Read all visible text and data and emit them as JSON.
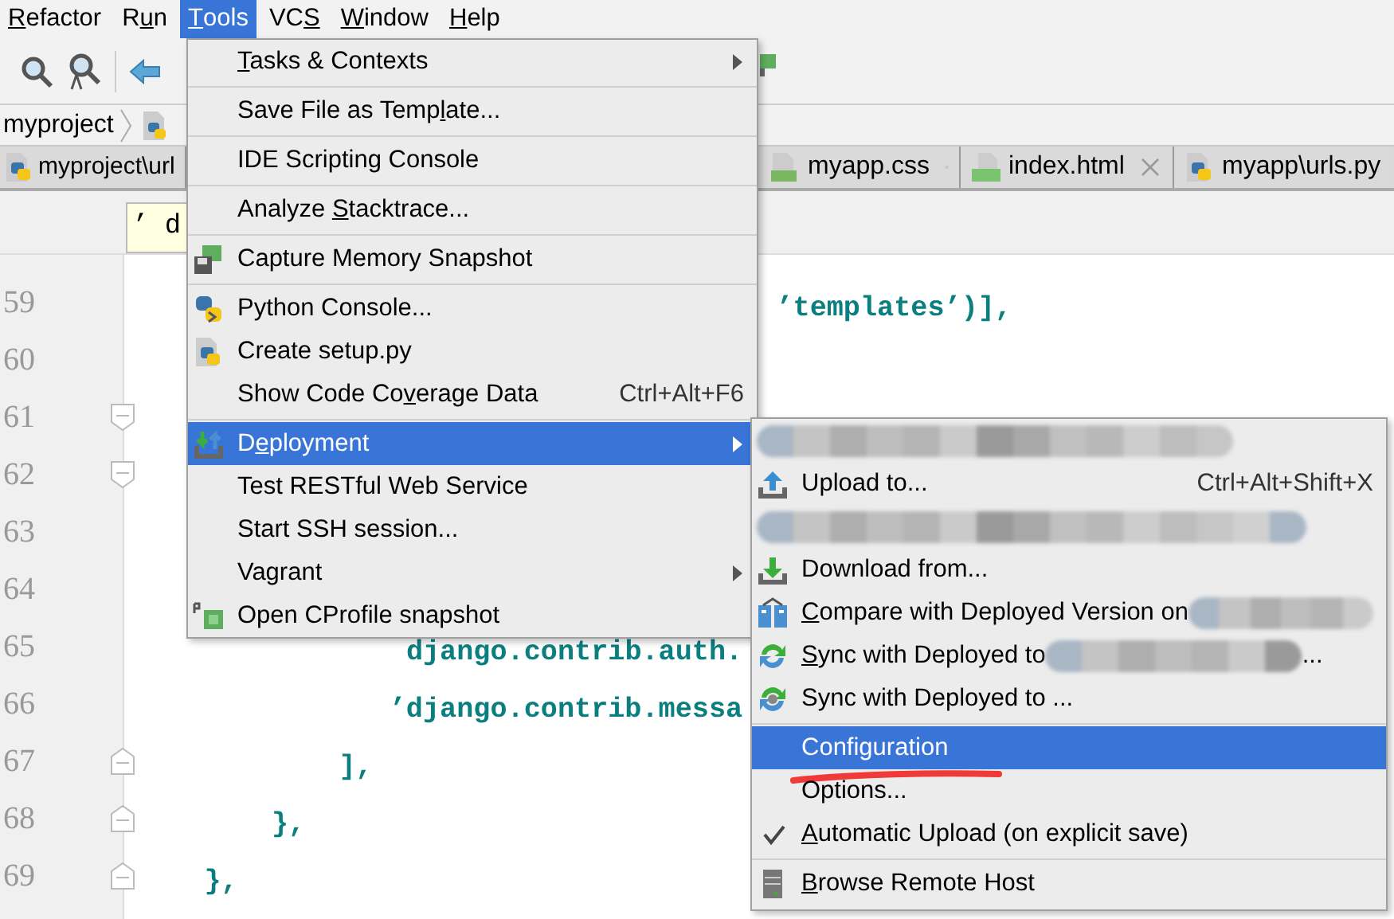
{
  "menu_bar": [
    {
      "mnemonic": {
        "key": "R",
        "after": "efactor"
      },
      "selected": false
    },
    {
      "mnemonic": {
        "before": "R",
        "key": "u",
        "after": "n"
      },
      "selected": false
    },
    {
      "mnemonic": {
        "key": "T",
        "after": "ools"
      },
      "selected": true
    },
    {
      "mnemonic": {
        "before": "VC",
        "key": "S"
      },
      "selected": false
    },
    {
      "mnemonic": {
        "key": "W",
        "after": "indow"
      },
      "selected": false
    },
    {
      "mnemonic": {
        "key": "H",
        "after": "elp"
      },
      "selected": false
    }
  ],
  "breadcrumb": {
    "label": "myproject"
  },
  "tabs": [
    {
      "label": "myproject\\url",
      "kind": "python"
    },
    {
      "label": "myapp.css",
      "kind": "css",
      "closable": true
    },
    {
      "label": "index.html",
      "kind": "html",
      "closable": true
    },
    {
      "label": "myapp\\urls.py",
      "kind": "python"
    }
  ],
  "tooltip": {
    "text": "’ d"
  },
  "editor": {
    "lines": [
      {
        "number": "59",
        "text": "                                      ’templates’)],",
        "fold_open": false,
        "fold_close": false
      },
      {
        "number": "60",
        "fold_open": false,
        "fold_close": false
      },
      {
        "number": "61",
        "fold_open": true,
        "fold_close": false
      },
      {
        "number": "62",
        "fold_open": true,
        "fold_close": false
      },
      {
        "number": "63",
        "fold_open": false,
        "fold_close": false
      },
      {
        "number": "64",
        "fold_open": false,
        "fold_close": false
      },
      {
        "number": "65",
        "text": "                django.contrib.auth.",
        "fold_open": false,
        "fold_close": false
      },
      {
        "number": "66",
        "text": "               ’django.contrib.messa",
        "fold_open": false,
        "fold_close": false
      },
      {
        "number": "67",
        "text": "            ],",
        "fold_open": false,
        "fold_close": true
      },
      {
        "number": "68",
        "text": "        },",
        "fold_open": false,
        "fold_close": true
      },
      {
        "number": "69",
        "text": "    },",
        "fold_open": false,
        "fold_close": true
      }
    ]
  },
  "tools_menu": [
    {
      "kind": "plain",
      "mnemonic": {
        "key": "T",
        "after": "asks & Contexts"
      },
      "submenu": true,
      "selected": false
    },
    {
      "kind": "separator"
    },
    {
      "kind": "plain",
      "mnemonic": {
        "before": "Save File as Temp",
        "key": "l",
        "after": "ate..."
      },
      "submenu": false,
      "selected": false
    },
    {
      "kind": "separator"
    },
    {
      "kind": "plain",
      "label": "IDE Scripting Console",
      "submenu": false,
      "selected": false
    },
    {
      "kind": "separator"
    },
    {
      "kind": "plain",
      "mnemonic": {
        "before": "Analyze ",
        "key": "S",
        "after": "tacktrace..."
      },
      "submenu": false,
      "selected": false
    },
    {
      "kind": "separator"
    },
    {
      "kind": "memory",
      "label": "Capture Memory Snapshot",
      "submenu": false,
      "selected": false
    },
    {
      "kind": "separator"
    },
    {
      "kind": "python",
      "label": "Python Console...",
      "submenu": false,
      "selected": false
    },
    {
      "kind": "setup",
      "label": "Create setup.py",
      "submenu": false,
      "selected": false
    },
    {
      "kind": "plain",
      "mnemonic": {
        "before": "Show Code Co",
        "key": "v",
        "after": "erage Data"
      },
      "shortcut": "Ctrl+Alt+F6",
      "submenu": false,
      "selected": false
    },
    {
      "kind": "separator"
    },
    {
      "kind": "deploy",
      "mnemonic": {
        "before": "D",
        "key": "e",
        "after": "ployment"
      },
      "submenu": true,
      "selected": true
    },
    {
      "kind": "plain",
      "label": "Test RESTful Web Service",
      "submenu": false,
      "selected": false
    },
    {
      "kind": "plain",
      "label": "Start SSH session...",
      "submenu": false,
      "selected": false
    },
    {
      "kind": "plain",
      "label": "Vagrant",
      "submenu": true,
      "selected": false
    },
    {
      "kind": "cprofile",
      "label": "Open CProfile snapshot",
      "submenu": false,
      "selected": false
    }
  ],
  "deployment_menu": [
    {
      "kind": "redacted",
      "selected": false
    },
    {
      "kind": "upload",
      "label": "Upload to...",
      "shortcut": "Ctrl+Alt+Shift+X",
      "selected": false
    },
    {
      "kind": "redacted",
      "selected": false
    },
    {
      "kind": "download",
      "label": "Download from...",
      "selected": false
    },
    {
      "kind": "compare",
      "mnemonic": {
        "key": "C",
        "after": "ompare with Deployed Version on"
      },
      "blurred_tail": true,
      "selected": false
    },
    {
      "kind": "sync",
      "mnemonic": {
        "key": "S",
        "after": "ync with Deployed to"
      },
      "blurred_tail": true,
      "suffix": "...",
      "selected": false
    },
    {
      "kind": "sync-gray",
      "label": "Sync with Deployed to ...",
      "blurred_tail": false,
      "selected": false
    },
    {
      "kind": "separator"
    },
    {
      "kind": "plain",
      "label": "Configuration",
      "selected": true,
      "marked": true
    },
    {
      "kind": "plain",
      "label": "Options...",
      "selected": false
    },
    {
      "kind": "check",
      "mnemonic": {
        "key": "A",
        "after": "utomatic Upload (on explicit save)"
      },
      "checked": true,
      "selected": false
    },
    {
      "kind": "separator"
    },
    {
      "kind": "server",
      "mnemonic": {
        "key": "B",
        "after": "rowse Remote Host"
      },
      "selected": false
    }
  ]
}
